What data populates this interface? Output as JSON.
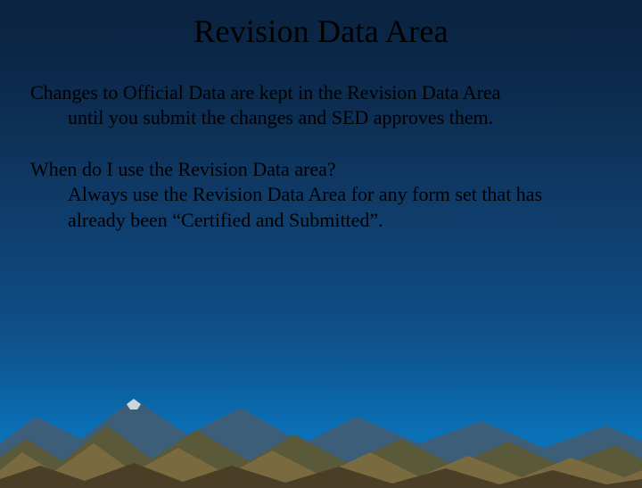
{
  "title": "Revision Data Area",
  "para1": {
    "line1": "Changes to Official Data are kept in the  Revision Data  Area",
    "line2": "until you submit the changes and SED approves them."
  },
  "para2": {
    "q": "When do I use the Revision Data area?",
    "line1": "Always use the Revision Data Area for any form set that has",
    "line2": "already been “Certified and Submitted”."
  }
}
